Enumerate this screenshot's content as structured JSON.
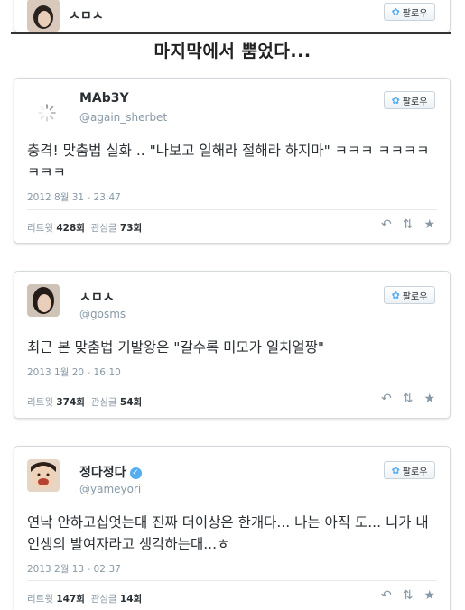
{
  "top_card": {
    "name": "ㅅㅁㅅ",
    "follow_label": "팔로우"
  },
  "page_title": "마지막에서 뿜었다...",
  "tweets": [
    {
      "name": "MAb3Y",
      "handle": "@again_sherbet",
      "text": "충격! 맞춤법 실화 .. \"나보고 일해라 절해라 하지마\" ㅋㅋㅋ ㅋㅋㅋㅋㅋㅋㅋ",
      "date": "2012 8월 31 - 23:47",
      "retweet_label": "리트윗",
      "retweet_count": "428회",
      "fav_label": "관심글",
      "fav_count": "73회",
      "follow_label": "팔로우"
    },
    {
      "name": "ㅅㅁㅅ",
      "handle": "@gosms",
      "text": "최근 본 맞춤법 기발왕은 \"갈수록 미모가 일치얼짱\"",
      "date": "2013 1월 20 - 16:10",
      "retweet_label": "리트윗",
      "retweet_count": "374회",
      "fav_label": "관심글",
      "fav_count": "54회",
      "follow_label": "팔로우"
    },
    {
      "name": "정다정다",
      "handle": "@yameyori",
      "text": "연낙 안하고십엇는대 진짜 더이상은 한개다... 나는 아직 도... 니가 내인생의 발여자라고 생각하는대...ㅎ",
      "date": "2013 2월 13 - 02:37",
      "retweet_label": "리트윗",
      "retweet_count": "147회",
      "fav_label": "관심글",
      "fav_count": "14회",
      "follow_label": "팔로우"
    }
  ],
  "icons": {
    "follow": "twitter-bird-icon",
    "reply": "reply-icon",
    "retweet": "retweet-icon",
    "favorite": "star-icon",
    "verified": "verified-badge-icon"
  },
  "colors": {
    "twitter_blue": "#55acee",
    "muted_text": "#8899a6",
    "body_text": "#292f33"
  }
}
